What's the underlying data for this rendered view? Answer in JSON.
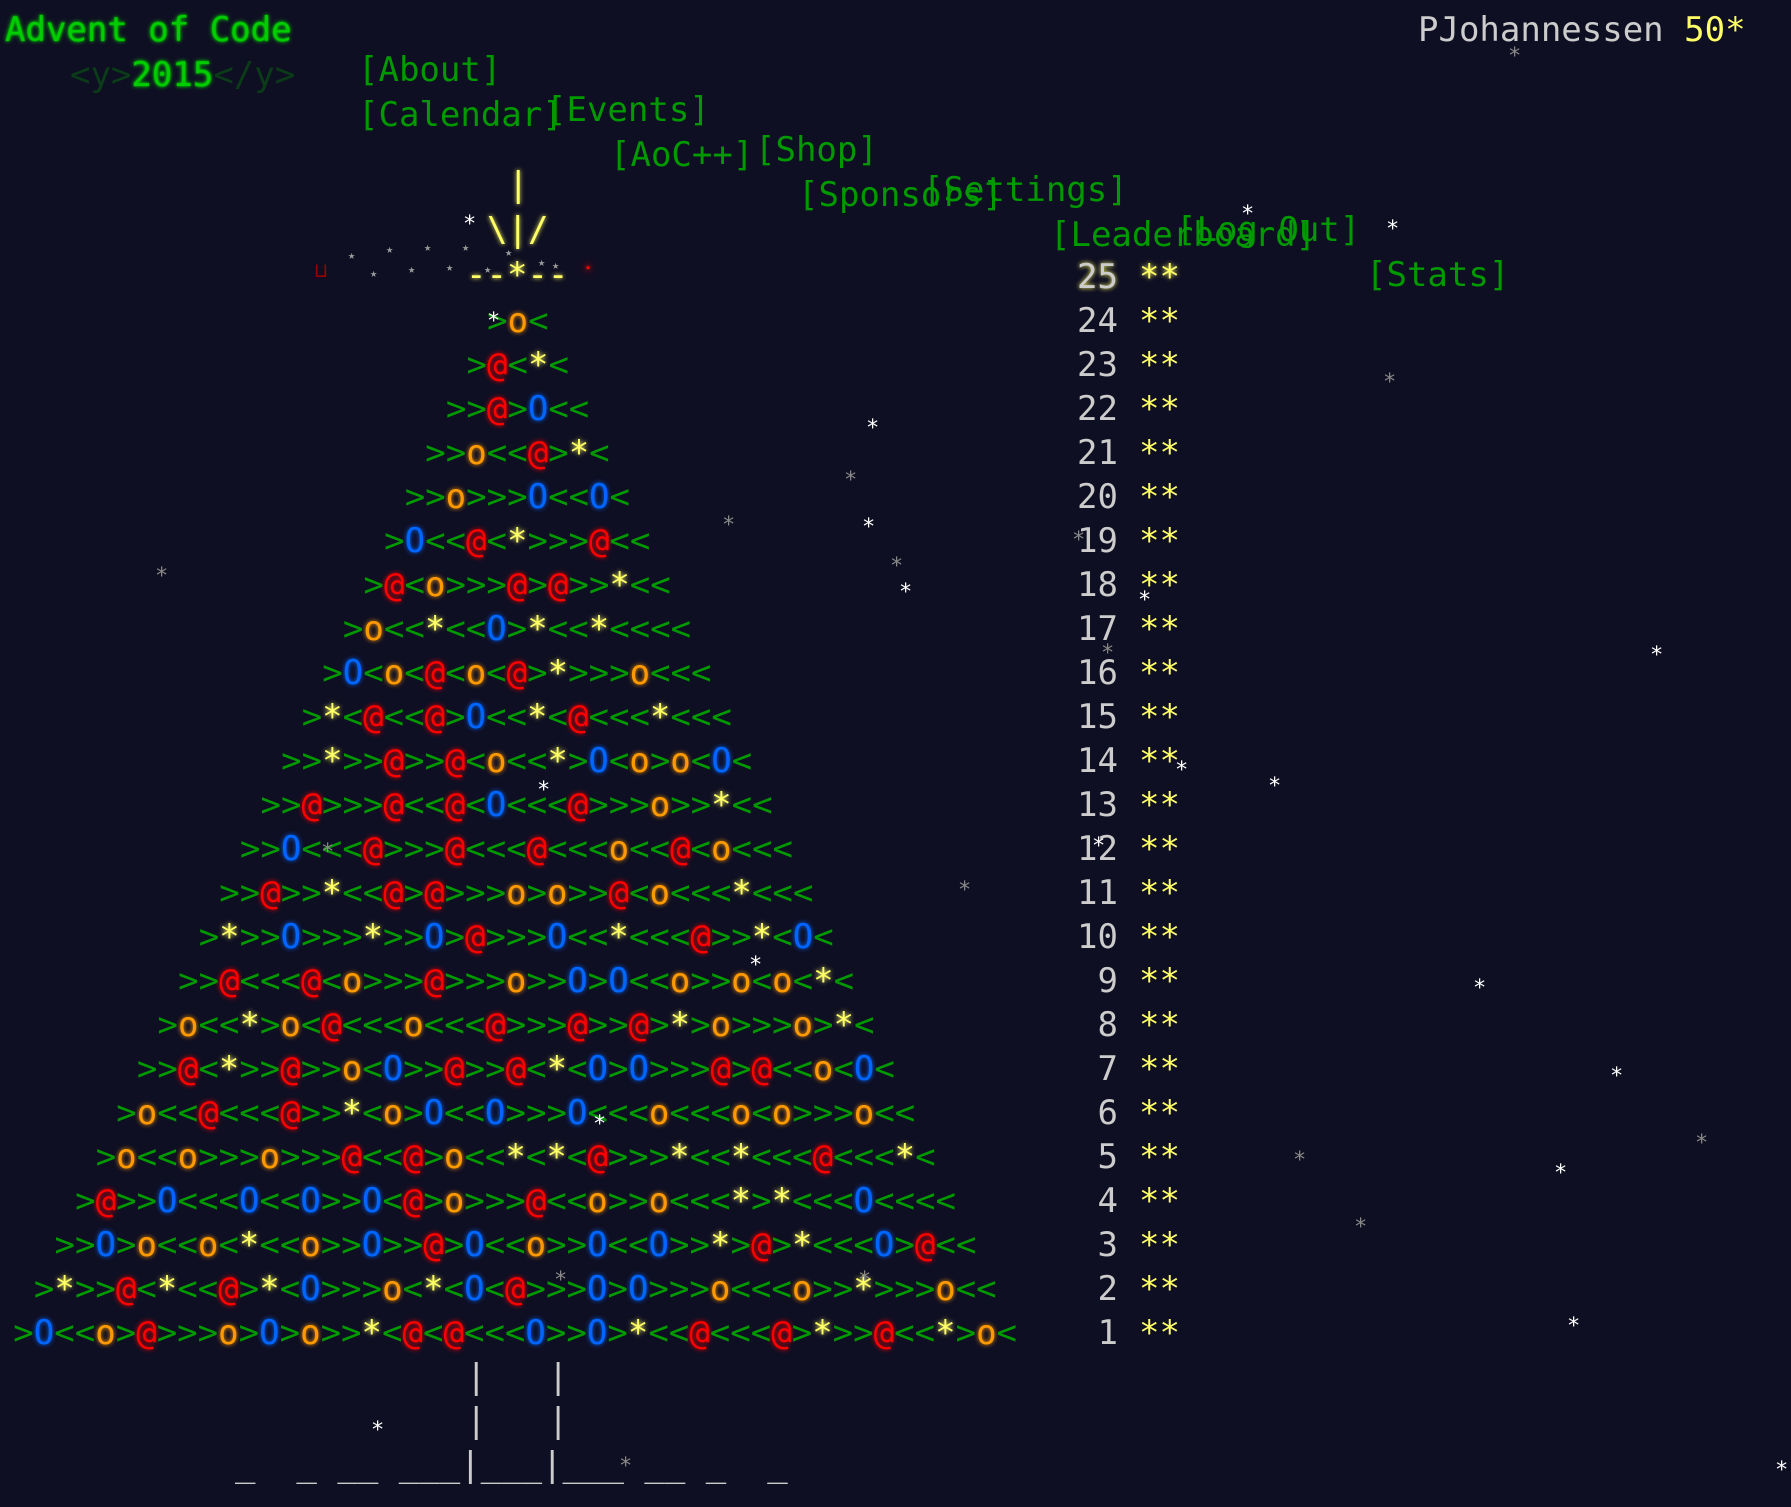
{
  "header": {
    "title": "Advent of Code",
    "year_open_tag": "<y>",
    "year": "2015",
    "year_close_tag": "</y>",
    "nav_primary": [
      "[About]",
      "[Events]",
      "[Shop]",
      "[Settings]",
      "[Log Out]"
    ],
    "nav_secondary": [
      "[Calendar]",
      "[AoC++]",
      "[Sponsors]",
      "[Leaderboard]",
      "[Stats]"
    ],
    "user": {
      "name": "PJohannessen",
      "stars": "50*"
    }
  },
  "colors": {
    "background": "#0f0f23",
    "title_green": "#00cc00",
    "link_green": "#009900",
    "star_yellow": "#ffff66",
    "ornament_orange": "#ff9900",
    "ornament_red": "#ff0000",
    "ornament_blue": "#0066ff",
    "text_gray": "#cccccc"
  },
  "tree": {
    "topper": [
      "|",
      "\\|/",
      "--*--"
    ],
    "rows": [
      {
        "day": "25",
        "stars": "**",
        "art": ""
      },
      {
        "day": "24",
        "stars": "**",
        "art": ">o<"
      },
      {
        "day": "23",
        "stars": "**",
        "art": ">@<*<"
      },
      {
        "day": "22",
        "stars": "**",
        "art": ">>@>O<<"
      },
      {
        "day": "21",
        "stars": "**",
        "art": ">>o<<@>*<"
      },
      {
        "day": "20",
        "stars": "**",
        "art": ">>o>>>O<<O<"
      },
      {
        "day": "19",
        "stars": "**",
        "art": ">O<<@<*>>>@<<"
      },
      {
        "day": "18",
        "stars": "**",
        "art": ">@<o>>>@>@>>*<<"
      },
      {
        "day": "17",
        "stars": "**",
        "art": ">o<<*<<O>*<<*<<<<"
      },
      {
        "day": "16",
        "stars": "**",
        "art": ">O<o<@<o<@>*>>>o<<<"
      },
      {
        "day": "15",
        "stars": "**",
        "art": ">*<@<<@>O<<*<@<<<*<<<"
      },
      {
        "day": "14",
        "stars": "**",
        "art": ">>*>>@>>@<o<<*>O<o>o<O<"
      },
      {
        "day": "13",
        "stars": "**",
        "art": ">>@>>>@<<@<O<<<@>>>o>>*<<"
      },
      {
        "day": "12",
        "stars": "**",
        "art": ">>O<<<@>>>@<<<@<<<o<<@<o<<<"
      },
      {
        "day": "11",
        "stars": "**",
        "art": ">>@>>*<<@>@>>>o>o>>@<o<<<*<<<"
      },
      {
        "day": "10",
        "stars": "**",
        "art": ">*>>O>>>*>>O>@>>>O<<*<<<@>>*<O<"
      },
      {
        "day": "9",
        "stars": "**",
        "art": ">>@<<<@<o>>>@>>>o>>O>O<<o>>o<o<*<"
      },
      {
        "day": "8",
        "stars": "**",
        "art": ">o<<*>o<@<<<o<<<@>>>@>>@>*>o>>>o>*<"
      },
      {
        "day": "7",
        "stars": "**",
        "art": ">>@<*>>@>>o<O>>@>>@<*<O>O>>>@>@<<o<O<"
      },
      {
        "day": "6",
        "stars": "**",
        "art": ">o<<@<<<@>>*<o>O<<O>>>O<<<o<<<o<o>>>o<<"
      },
      {
        "day": "5",
        "stars": "**",
        "art": ">o<<o>>>o>>>@<<@>o<<*<*<@>>>*<<*<<<@<<<*<"
      },
      {
        "day": "4",
        "stars": "**",
        "art": ">@>>O<<<O<<O>>O<@>o>>>@<<o>>o<<<*>*<<<O<<<<"
      },
      {
        "day": "3",
        "stars": "**",
        "art": ">>O>o<<o<*<<o>>O>>@>O<<o>>O<<O>>*>@>*<<<O>@<<"
      },
      {
        "day": "2",
        "stars": "**",
        "art": ">*>>@<*<<@>*<O>>>o<*<O<@>>>O>O>>>o<<<o>>*>>>o<<"
      },
      {
        "day": "1",
        "stars": "**",
        "art": ">O<<o>@>>>o>O>o>>*<@<@<<<O>>O>*<<@<<<@>*>>@<<*>o<"
      }
    ],
    "trunk": [
      "|   |",
      "|   |",
      "_  _ __ ___|___|___ __ _  _"
    ]
  }
}
